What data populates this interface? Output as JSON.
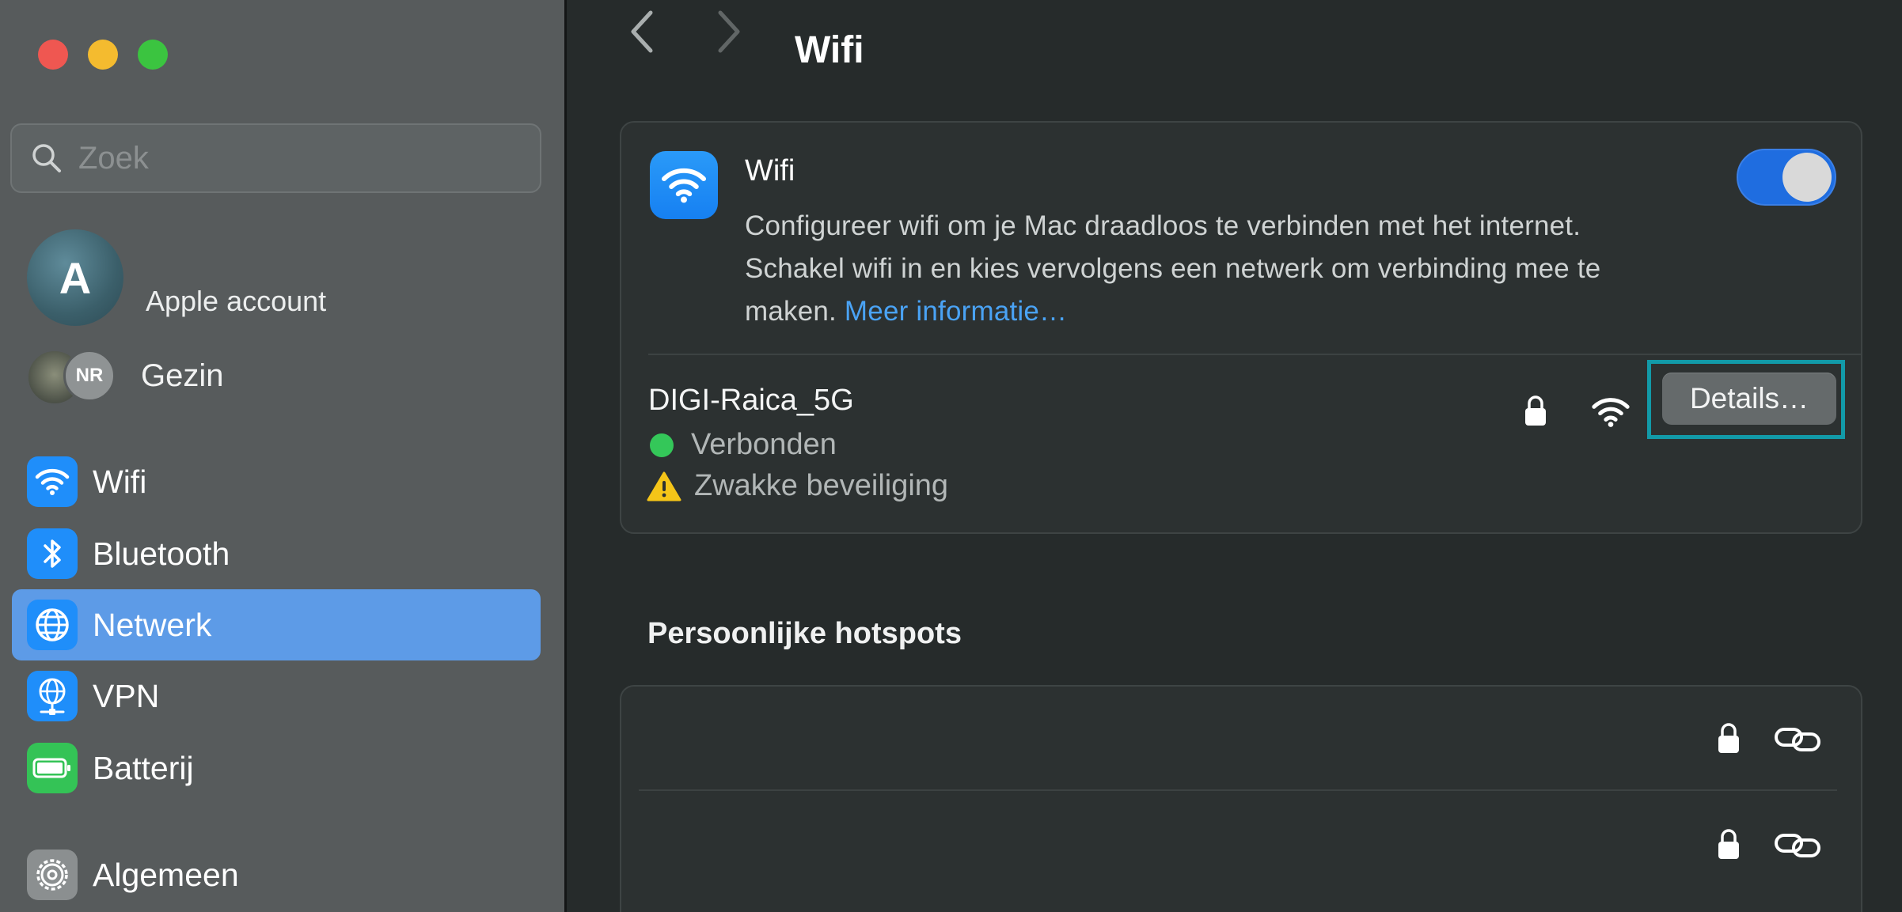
{
  "window": {
    "traffic_lights": [
      "close",
      "minimize",
      "maximize"
    ]
  },
  "sidebar": {
    "search_placeholder": "Zoek",
    "account": {
      "initial": "A",
      "label": "Apple account"
    },
    "family": {
      "initials": "NR",
      "label": "Gezin"
    },
    "items": [
      {
        "label": "Wifi",
        "icon": "wifi-icon",
        "color": "#1f8efa"
      },
      {
        "label": "Bluetooth",
        "icon": "bluetooth-icon",
        "color": "#1f8efa"
      },
      {
        "label": "Netwerk",
        "icon": "globe-icon",
        "color": "#1f8efa",
        "active": true
      },
      {
        "label": "VPN",
        "icon": "vpn-globe-icon",
        "color": "#1f8efa"
      },
      {
        "label": "Batterij",
        "icon": "battery-icon",
        "color": "#34c356"
      },
      {
        "label": "Algemeen",
        "icon": "gear-icon",
        "color": "#8b8f90"
      }
    ]
  },
  "main": {
    "title": "Wifi",
    "wifi_card": {
      "title": "Wifi",
      "description": "Configureer wifi om je Mac draadloos te verbinden met het internet. Schakel wifi in en kies vervolgens een netwerk om verbinding mee te maken.",
      "desc_line1": "Configureer wifi om je Mac draadloos te verbinden met het internet.",
      "desc_line2": "Schakel wifi in en kies vervolgens een netwerk om verbinding mee te",
      "desc_line3": "maken.",
      "link": "Meer informatie…",
      "toggle_on": true
    },
    "network": {
      "name": "DIGI-Raica_5G",
      "status": "Verbonden",
      "warning": "Zwakke beveiliging",
      "details_button": "Details…"
    },
    "hotspots": {
      "section_title": "Persoonlijke hotspots",
      "rows": [
        {
          "name": ""
        },
        {
          "name": ""
        }
      ]
    }
  },
  "colors": {
    "accent": "#1f8efa",
    "selection": "#5d9be7",
    "highlight_box": "#129aa8",
    "connected": "#34c759",
    "warning": "#f5c518",
    "link": "#4aa3f5"
  }
}
